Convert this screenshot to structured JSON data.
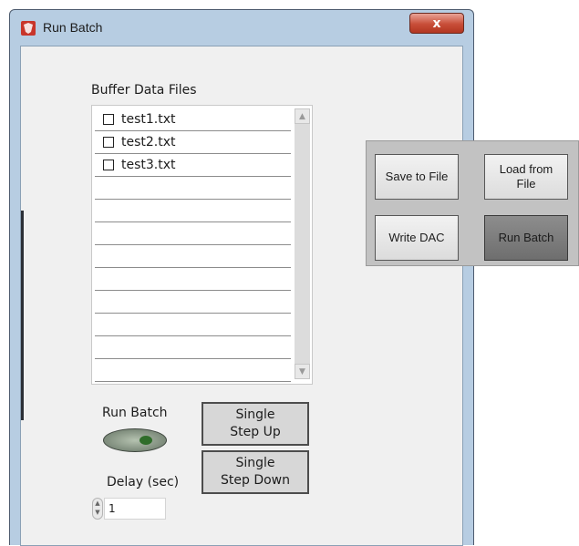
{
  "window": {
    "title": "Run Batch",
    "close_label": "x"
  },
  "buffer": {
    "label": "Buffer Data Files",
    "files": [
      "test1.txt",
      "test2.txt",
      "test3.txt",
      "",
      "",
      "",
      "",
      "",
      "",
      "",
      "",
      ""
    ]
  },
  "controls": {
    "run_batch_label": "Run Batch",
    "delay_label": "Delay (sec)",
    "delay_value": "1",
    "single_step_up": "Single\nStep Up",
    "single_step_down": "Single\nStep Down"
  },
  "panel": {
    "save_to_file": "Save to File",
    "load_from_file": "Load from\nFile",
    "write_dac": "Write DAC",
    "run_batch": "Run Batch"
  }
}
